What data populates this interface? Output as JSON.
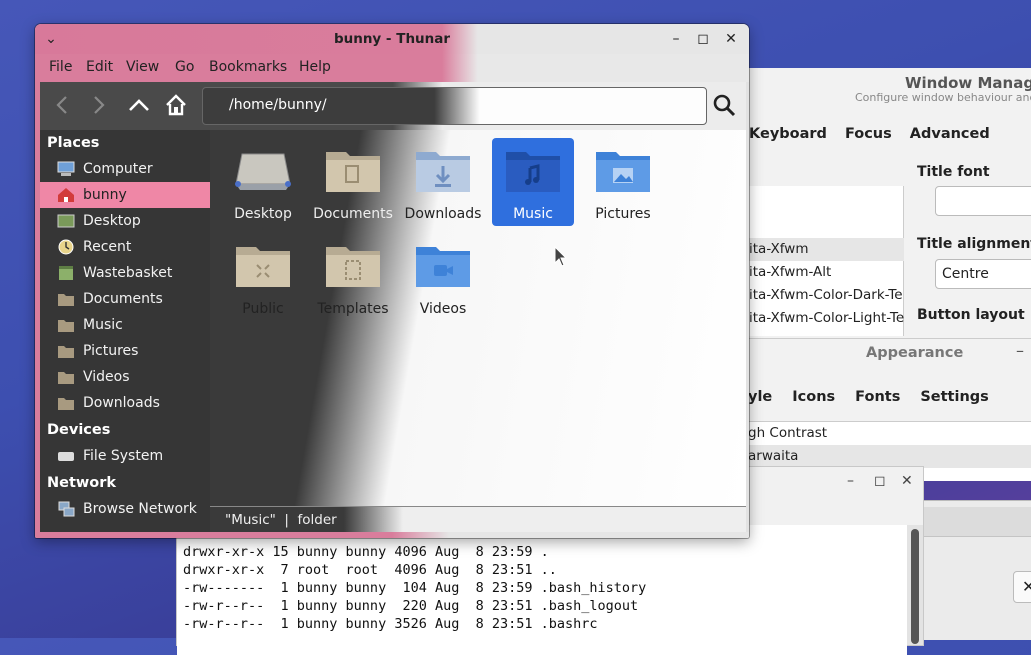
{
  "window_manager": {
    "title": "Window Manager",
    "subtitle": "Configure window behaviour and",
    "tabs": [
      "Keyboard",
      "Focus",
      "Advanced"
    ],
    "theme_list": [
      "ita-Xfwm",
      "ita-Xfwm-Alt",
      "ita-Xfwm-Color-Dark-Te",
      "ita-Xfwm-Color-Light-Te"
    ],
    "title_font_label": "Title font",
    "title_alignment_label": "Title alignment",
    "title_alignment_value": "Centre",
    "button_layout_label": "Button layout"
  },
  "appearance": {
    "title": "Appearance",
    "tabs": [
      "yle",
      "Icons",
      "Fonts",
      "Settings"
    ],
    "list": [
      "gh Contrast",
      "arwaita"
    ]
  },
  "terminal": {
    "lines": [
      "drwxr-xr-x 15 bunny bunny 4096 Aug  8 23:59 .",
      "drwxr-xr-x  7 root  root  4096 Aug  8 23:51 ..",
      "-rw-------  1 bunny bunny  104 Aug  8 23:59 .bash_history",
      "-rw-r--r--  1 bunny bunny  220 Aug  8 23:51 .bash_logout",
      "-rw-r--r--  1 bunny bunny 3526 Aug  8 23:51 .bashrc"
    ]
  },
  "thunar": {
    "title": "bunny - Thunar",
    "menu": [
      "File",
      "Edit",
      "View",
      "Go",
      "Bookmarks",
      "Help"
    ],
    "path": "/home/bunny/",
    "sidebar": {
      "places_header": "Places",
      "places": [
        "Computer",
        "bunny",
        "Desktop",
        "Recent",
        "Wastebasket",
        "Documents",
        "Music",
        "Pictures",
        "Videos",
        "Downloads"
      ],
      "devices_header": "Devices",
      "devices": [
        "File System"
      ],
      "network_header": "Network",
      "network": [
        "Browse Network"
      ]
    },
    "files": [
      "Desktop",
      "Documents",
      "Downloads",
      "Music",
      "Pictures",
      "Public",
      "Templates",
      "Videos"
    ],
    "selected_file": "Music",
    "status": "\"Music\"  |  folder"
  },
  "colors": {
    "accent_pink": "#d97d9c",
    "selection_blue": "#2f6fde",
    "folder_blue": "#4a90e2",
    "folder_tan": "#c8b89c"
  }
}
